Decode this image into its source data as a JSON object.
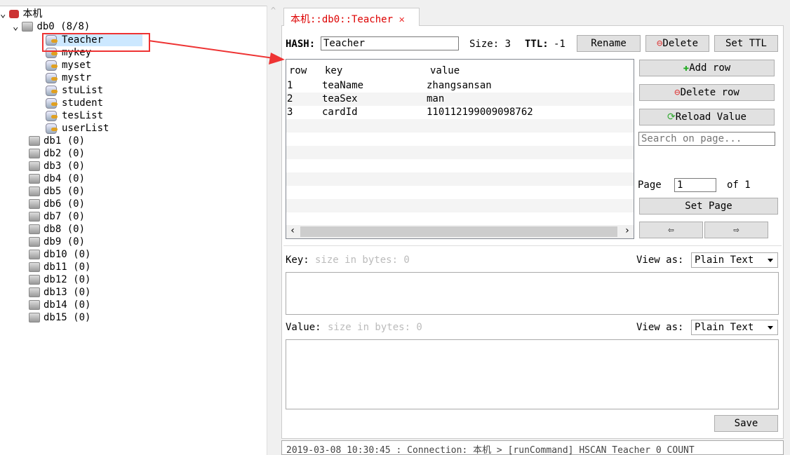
{
  "tree": {
    "root": "本机",
    "db0": {
      "label": "db0  (8/8)",
      "keys": [
        "Teacher",
        "mykey",
        "myset",
        "mystr",
        "stuList",
        "student",
        "tesList",
        "userList"
      ],
      "selected": "Teacher"
    },
    "dbs": [
      "db1  (0)",
      "db2  (0)",
      "db3  (0)",
      "db4  (0)",
      "db5  (0)",
      "db6  (0)",
      "db7  (0)",
      "db8  (0)",
      "db9  (0)",
      "db10  (0)",
      "db11  (0)",
      "db12  (0)",
      "db13  (0)",
      "db14  (0)",
      "db15  (0)"
    ]
  },
  "tab": {
    "title": "本机::db0::Teacher"
  },
  "header": {
    "type_label": "HASH:",
    "key_name": "Teacher",
    "size": "Size: 3",
    "ttl_label": "TTL:",
    "ttl": "-1",
    "rename": "Rename",
    "delete": "Delete",
    "set_ttl": "Set TTL"
  },
  "table": {
    "columns": [
      "row",
      "key",
      "value"
    ],
    "rows": [
      [
        "1",
        "teaName",
        "zhangsansan"
      ],
      [
        "2",
        "teaSex",
        "man"
      ],
      [
        "3",
        "cardId",
        "110112199009098762"
      ]
    ]
  },
  "side": {
    "add_row": "Add row",
    "delete_row": "Delete row",
    "reload": "Reload Value",
    "search_placeholder": "Search on page...",
    "page_label": "Page",
    "page": "1",
    "of": "of 1",
    "set_page": "Set Page",
    "prev": "⇦",
    "next": "⇨"
  },
  "key_editor": {
    "label": "Key:",
    "size_hint": "size in bytes: 0",
    "view_as": "View as:",
    "format": "Plain Text"
  },
  "value_editor": {
    "label": "Value:",
    "size_hint": "size in bytes: 0",
    "view_as": "View as:",
    "format": "Plain Text"
  },
  "save": "Save",
  "log": [
    "2019-03-08 10:30:45 : Connection: 本机 > [runCommand] HSCAN Teacher 0 COUNT"
  ],
  "colors": {
    "accent": "#dd0000",
    "highlight": "#cce8ff",
    "annotation": "#ee3333"
  }
}
